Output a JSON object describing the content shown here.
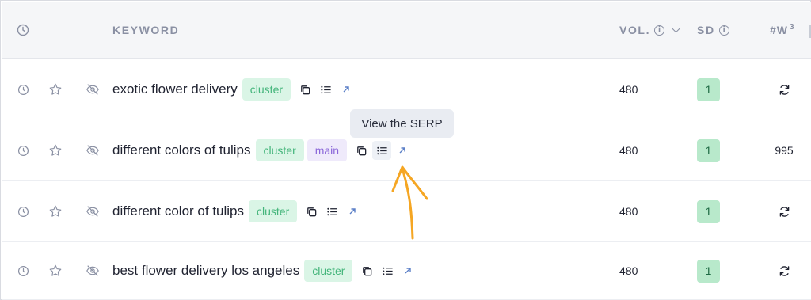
{
  "header": {
    "keyword_label": "KEYWORD",
    "vol_label": "VOL.",
    "sd_label": "SD",
    "words_label": "#W",
    "words_sup": "3",
    "info_glyph": "i"
  },
  "rows": [
    {
      "keyword": "exotic flower delivery",
      "badges": [
        "cluster"
      ],
      "volume": "480",
      "sd": "1",
      "words": "refresh-icon"
    },
    {
      "keyword": "different colors of tulips",
      "badges": [
        "cluster",
        "main"
      ],
      "volume": "480",
      "sd": "1",
      "words": "995"
    },
    {
      "keyword": "different color of tulips",
      "badges": [
        "cluster"
      ],
      "volume": "480",
      "sd": "1",
      "words": "refresh-icon"
    },
    {
      "keyword": "best flower delivery los angeles",
      "badges": [
        "cluster"
      ],
      "volume": "480",
      "sd": "1",
      "words": "refresh-icon"
    }
  ],
  "tooltip": {
    "text": "View the SERP"
  },
  "colors": {
    "cluster_bg": "#daf5e6",
    "cluster_text": "#44b57b",
    "main_bg": "#efeafb",
    "main_text": "#8a66d9",
    "sd_bg": "#b8e9cb",
    "annotation_arrow": "#f5a623"
  }
}
